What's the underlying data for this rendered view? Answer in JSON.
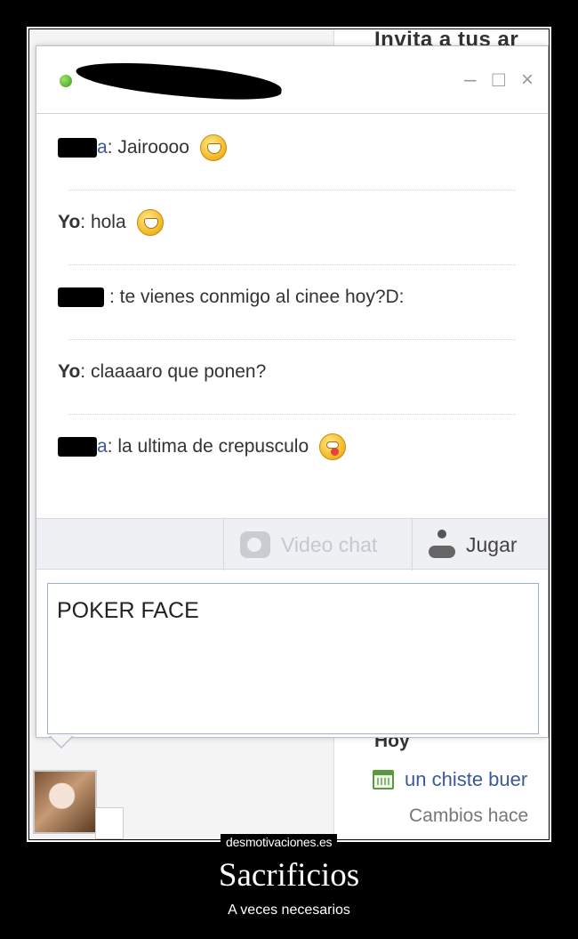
{
  "background_page": {
    "invite_text": "Invita a tus ar",
    "section_today": "Hoy",
    "event_link": "un chiste buer",
    "changes_text": "Cambios hace"
  },
  "chat": {
    "contact_name_redacted": true,
    "status": "online",
    "status_color": "#4caf24",
    "window_controls": [
      "minimize-icon",
      "maximize-icon",
      "close-icon"
    ],
    "window_control_glyphs": [
      "–",
      "□",
      "×"
    ],
    "messages": [
      {
        "sender": "a",
        "text": ": Jairoooo",
        "emoji": "grin"
      },
      {
        "sender": "Yo",
        "text": ": hola",
        "emoji": "grin"
      },
      {
        "sender": "",
        "text": ": te vienes conmigo al cinee hoy?D:",
        "emoji": ""
      },
      {
        "sender": "Yo",
        "text": ": claaaaro que ponen?",
        "emoji": ""
      },
      {
        "sender": "a",
        "text": ": la ultima de crepusculo",
        "emoji": "tongue"
      }
    ],
    "toolbar": {
      "video_chat": "Video chat",
      "play": "Jugar"
    },
    "composer_text": "POKER FACE"
  },
  "poster": {
    "site": "desmotivaciones.es",
    "title": "Sacrificios",
    "subtitle": "A veces necesarios"
  }
}
